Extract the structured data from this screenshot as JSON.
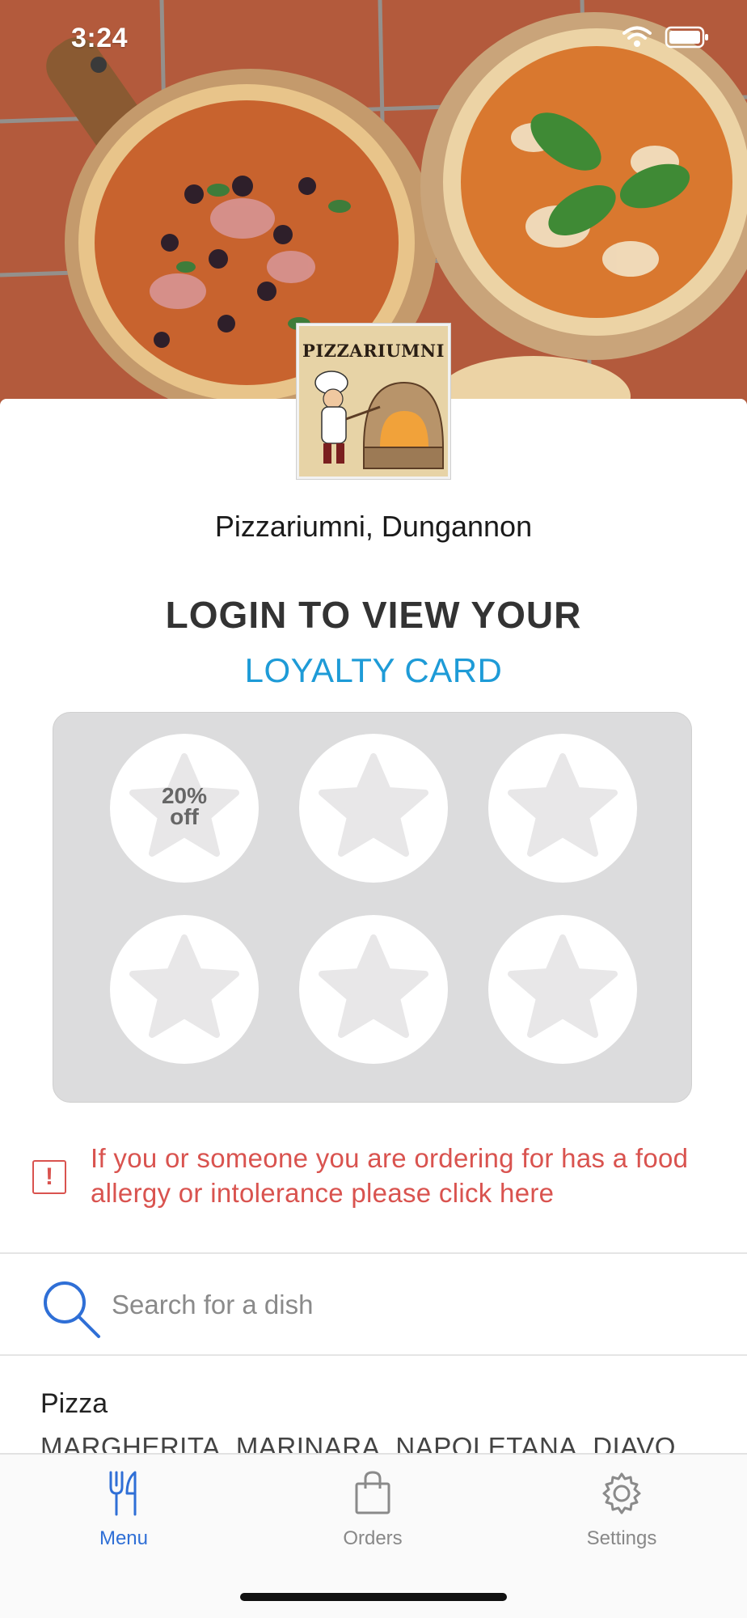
{
  "status_bar": {
    "time": "3:24"
  },
  "logo": {
    "text": "PIZZARIUMNI"
  },
  "restaurant": {
    "name": "Pizzariumni, Dungannon"
  },
  "loyalty": {
    "heading_line1": "LOGIN TO VIEW YOUR",
    "heading_line2": "LOYALTY CARD",
    "stamps": [
      {
        "label_line1": "20%",
        "label_line2": "off"
      },
      {
        "label_line1": "",
        "label_line2": ""
      },
      {
        "label_line1": "",
        "label_line2": ""
      },
      {
        "label_line1": "",
        "label_line2": ""
      },
      {
        "label_line1": "",
        "label_line2": ""
      },
      {
        "label_line1": "",
        "label_line2": ""
      }
    ]
  },
  "allergy": {
    "text": "If you or someone you are ordering for has a food allergy or intolerance please click here",
    "icon": "exclamation-icon"
  },
  "search": {
    "placeholder": "Search for a dish"
  },
  "category": {
    "title": "Pizza",
    "items": "MARGHERITA, MARINARA, NAPOLETANA, DIAVOLA"
  },
  "tabbar": {
    "tabs": [
      {
        "label": "Menu",
        "icon": "fork-knife-icon",
        "active": true
      },
      {
        "label": "Orders",
        "icon": "shopping-bag-icon",
        "active": false
      },
      {
        "label": "Settings",
        "icon": "gear-icon",
        "active": false
      }
    ]
  },
  "colors": {
    "accent_blue": "#1e9bd7",
    "tab_active": "#2f6fd6",
    "allergy_red": "#d9534f",
    "loyalty_bg": "#dcdcdd"
  }
}
